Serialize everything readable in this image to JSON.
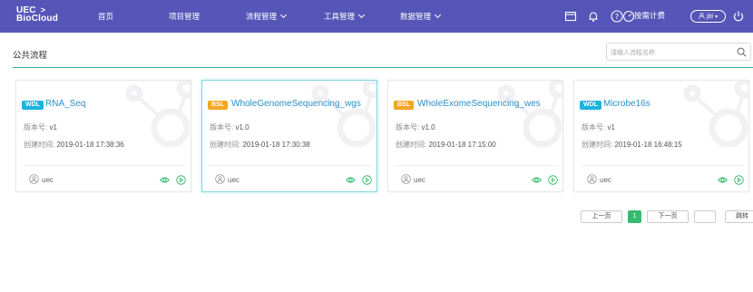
{
  "header": {
    "logo_line1": "UEC",
    "logo_line2": "BioCloud",
    "logo_arrow": ">",
    "nav": [
      "首页",
      "项目管理",
      "流程管理",
      "工具管理",
      "数据管理"
    ],
    "billing_label": "按需计费",
    "user_label": "jiti"
  },
  "page": {
    "section_title": "公共流程",
    "search_placeholder": "请输入流程名称"
  },
  "labels": {
    "version": "版本号:",
    "created": "创建时间:"
  },
  "cards": [
    {
      "tag": "WDL",
      "name": "RNA_Seq",
      "version": "v1",
      "created": "2019-01-18 17:38:36",
      "owner": "uec"
    },
    {
      "tag": "BSL",
      "name": "WholeGenomeSequencing_wgs",
      "version": "v1.0",
      "created": "2019-01-18 17:30:38",
      "owner": "uec"
    },
    {
      "tag": "BSL",
      "name": "WholeExomeSequencing_wes",
      "version": "v1.0",
      "created": "2019-01-18 17:15:00",
      "owner": "uec"
    },
    {
      "tag": "WDL",
      "name": "Microbe16s",
      "version": "v1",
      "created": "2019-01-18 16:48:15",
      "owner": "uec"
    }
  ],
  "pagination": {
    "prev": "上一页",
    "current": "1",
    "next": "下一页",
    "jump": "跳转"
  },
  "colors": {
    "header_bg": "#5656b8",
    "wdl_tag": "#1db3e0",
    "bsl_tag": "#f5a623",
    "accent_green": "#37b96f",
    "link_blue": "#2a8fc9"
  },
  "icons": {
    "window": "window-icon",
    "bell": "bell-icon",
    "help": "help-icon",
    "billing": "billing-gauge-icon",
    "user": "user-icon",
    "power": "power-icon",
    "search": "search-icon",
    "view": "eye-icon",
    "run": "play-icon"
  }
}
